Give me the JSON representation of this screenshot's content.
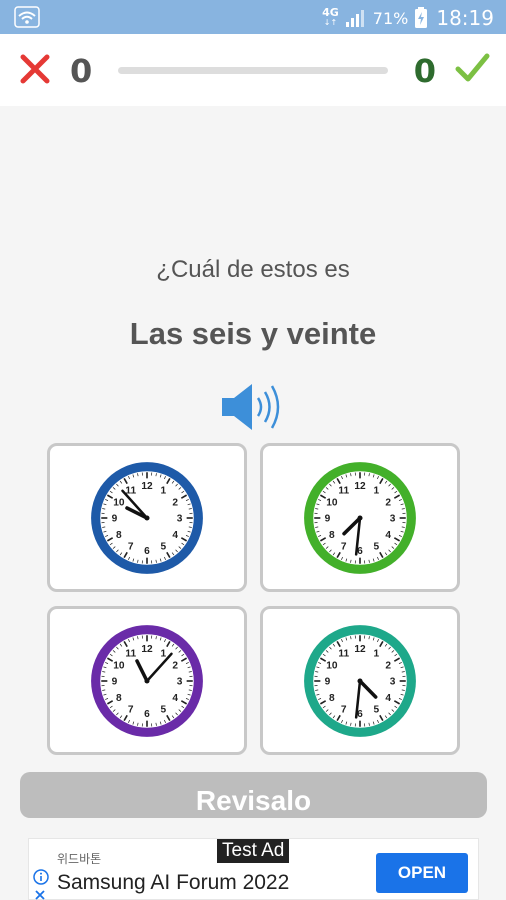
{
  "status_bar": {
    "network_label": "4G",
    "network_sub": "↓↑",
    "battery_percent": "71%",
    "time": "18:19",
    "wifi_icon": "wifi-icon",
    "signal_icon": "signal-icon",
    "battery_icon": "battery-charging-icon",
    "background": "#88b4e0"
  },
  "score": {
    "wrong_count": "0",
    "right_count": "0",
    "progress": 0,
    "wrong_icon": "red-x-icon",
    "right_icon": "green-check-icon",
    "wrong_color": "#e53935",
    "right_color": "#7cc043"
  },
  "question": {
    "prompt": "¿Cuál de estos es",
    "answer_text": "Las seis y veinte",
    "speaker_icon": "speaker-icon"
  },
  "options": [
    {
      "hour": 9,
      "minute": 53,
      "rim_color": "#1e5aa8"
    },
    {
      "hour": 7,
      "minute": 31,
      "rim_color": "#43b02a"
    },
    {
      "hour": 11,
      "minute": 7,
      "rim_color": "#6a2ba8"
    },
    {
      "hour": 4,
      "minute": 31,
      "rim_color": "#1ea88a"
    }
  ],
  "check_button": {
    "label": "Revisalo"
  },
  "ad": {
    "label": "Test Ad",
    "advertiser": "위드바톤",
    "title": "Samsung AI Forum 2022",
    "open_label": "OPEN",
    "info_icon": "info-icon",
    "close_icon": "close-icon",
    "accent": "#1a73e8"
  }
}
